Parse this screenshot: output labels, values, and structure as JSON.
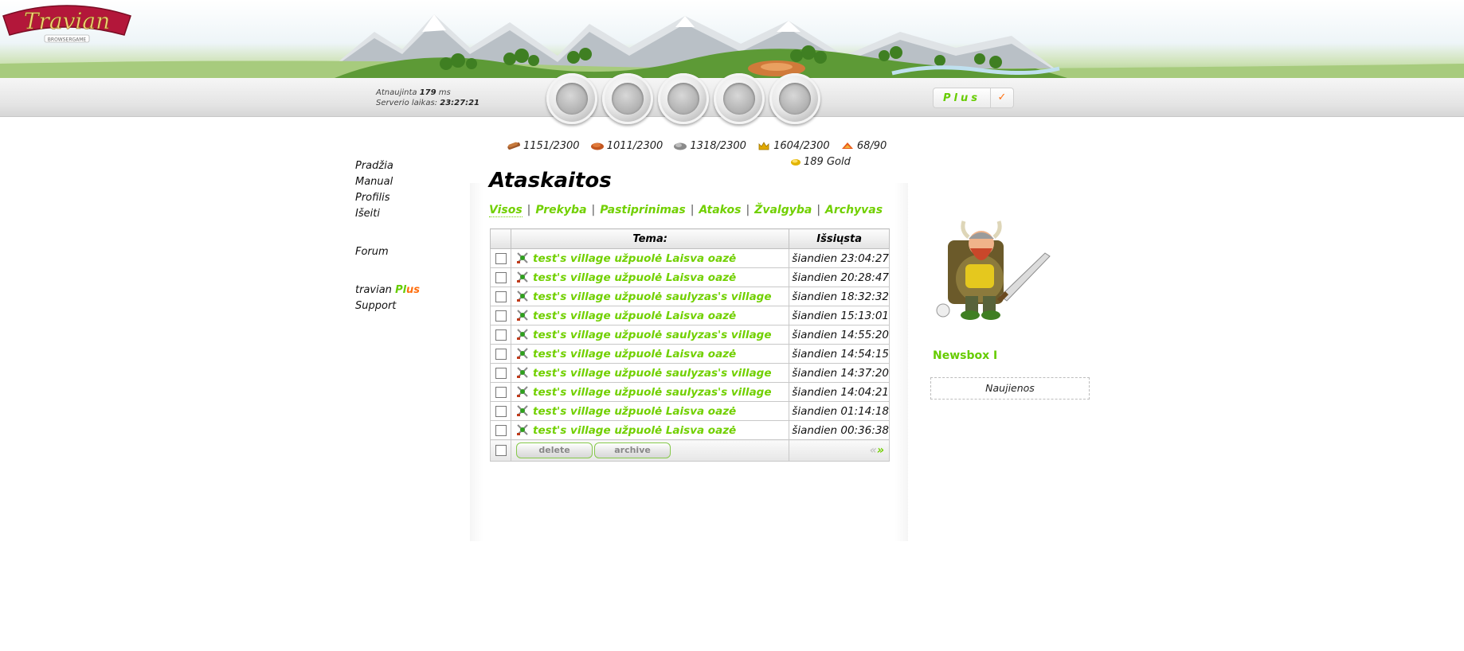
{
  "header": {
    "logo_text": "Travian",
    "logo_subtitle": "BROWSERGAME",
    "updated_label": "Atnaujinta",
    "updated_value": "179",
    "updated_unit": "ms",
    "server_time_label": "Serverio laikas:",
    "server_time_value": "23:27:21",
    "plus_label": "Plus",
    "plus_check": "✓"
  },
  "nav_icons": [
    "village-overview-icon",
    "village-center-icon",
    "map-icon",
    "statistics-icon",
    "reports-icon"
  ],
  "resources": {
    "lumber": "1151/2300",
    "clay": "1011/2300",
    "iron": "1318/2300",
    "crop": "1604/2300",
    "crop_consumption": "68/90",
    "gold": "189 Gold"
  },
  "menu": {
    "home": "Pradžia",
    "manual": "Manual",
    "profile": "Profilis",
    "logout": "Išeiti",
    "forum": "Forum",
    "travian_prefix": "travian ",
    "plus_p": "Pl",
    "plus_us": "us",
    "support": "Support"
  },
  "page": {
    "title": "Ataskaitos"
  },
  "filters": {
    "all": "Visos",
    "trade": "Prekyba",
    "reinforcement": "Pastiprinimas",
    "attacks": "Atakos",
    "scouting": "Žvalgyba",
    "archive": "Archyvas",
    "separator": "|"
  },
  "table": {
    "col_subject": "Tema:",
    "col_sent": "Išsiųsta",
    "rows": [
      {
        "subject": "test's village užpuolė Laisva oazė",
        "sent": "šiandien 23:04:27"
      },
      {
        "subject": "test's village užpuolė Laisva oazė",
        "sent": "šiandien 20:28:47"
      },
      {
        "subject": "test's village užpuolė saulyzas's village",
        "sent": "šiandien 18:32:32"
      },
      {
        "subject": "test's village užpuolė Laisva oazė",
        "sent": "šiandien 15:13:01"
      },
      {
        "subject": "test's village užpuolė saulyzas's village",
        "sent": "šiandien 14:55:20"
      },
      {
        "subject": "test's village užpuolė Laisva oazė",
        "sent": "šiandien 14:54:15"
      },
      {
        "subject": "test's village užpuolė saulyzas's village",
        "sent": "šiandien 14:37:20"
      },
      {
        "subject": "test's village užpuolė saulyzas's village",
        "sent": "šiandien 14:04:21"
      },
      {
        "subject": "test's village užpuolė Laisva oazė",
        "sent": "šiandien 01:14:18"
      },
      {
        "subject": "test's village užpuolė Laisva oazė",
        "sent": "šiandien 00:36:38"
      }
    ],
    "delete_label": "delete",
    "archive_label": "archive",
    "prev_label": "«",
    "next_label": "»"
  },
  "sidebar": {
    "newsbox_title": "Newsbox I",
    "newsbox_content": "Naujienos"
  },
  "colors": {
    "link_green": "#71d000",
    "plus_orange": "#ff6f0f"
  }
}
